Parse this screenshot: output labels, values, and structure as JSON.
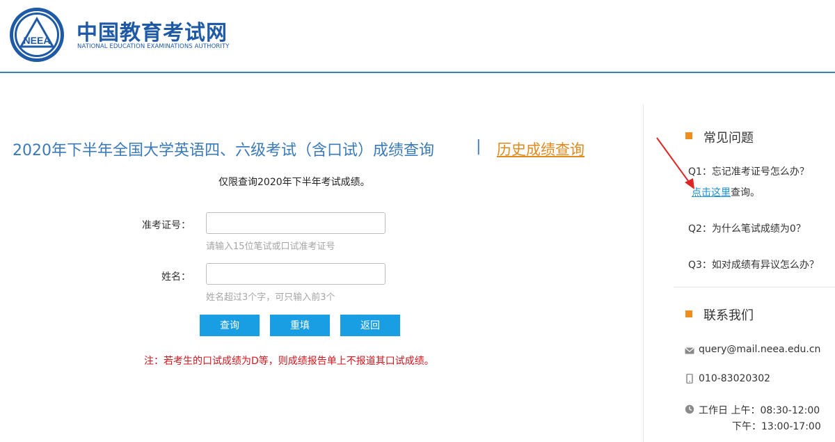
{
  "header": {
    "logo_emblem_text": "NEEA",
    "logo_cn": "中国教育考试网",
    "logo_en": "NATIONAL EDUCATION EXAMINATIONS AUTHORITY"
  },
  "main": {
    "title": "2020年下半年全国大学英语四、六级考试（含口试）成绩查询",
    "separator": "|",
    "history_link": "历史成绩查询",
    "subtitle": "仅限查询2020年下半年考试成绩。",
    "form": {
      "ticket": {
        "label": "准考证号：",
        "value": "",
        "hint": "请输入15位笔试或口试准考证号"
      },
      "name": {
        "label": "姓名：",
        "value": "",
        "hint": "姓名超过3个字，可只输入前3个"
      }
    },
    "buttons": {
      "query": "查询",
      "reset": "重填",
      "back": "返回"
    },
    "note": "注：若考生的口试成绩为D等，则成绩报告单上不报道其口试成绩。"
  },
  "sidebar": {
    "faq_heading": "常见问题",
    "faq": {
      "q1": "Q1：忘记准考证号怎么办？",
      "q1_link": "点击这里",
      "q1_suffix": "查询。",
      "q2": "Q2：为什么笔试成绩为0？",
      "q3": "Q3：如对成绩有异议怎么办？"
    },
    "contact_heading": "联系我们",
    "contact": {
      "email": "query@mail.neea.edu.cn",
      "phone": "010-83020302",
      "hours_am": "工作日 上午：08:30-12:00",
      "hours_pm": "下午：13:00-17:00"
    }
  },
  "colors": {
    "brand_blue": "#1f5aa6",
    "title_blue": "#3a7ab8",
    "button_blue": "#1a9ee3",
    "accent_orange": "#ef8d1d",
    "note_red": "#d0151b"
  }
}
